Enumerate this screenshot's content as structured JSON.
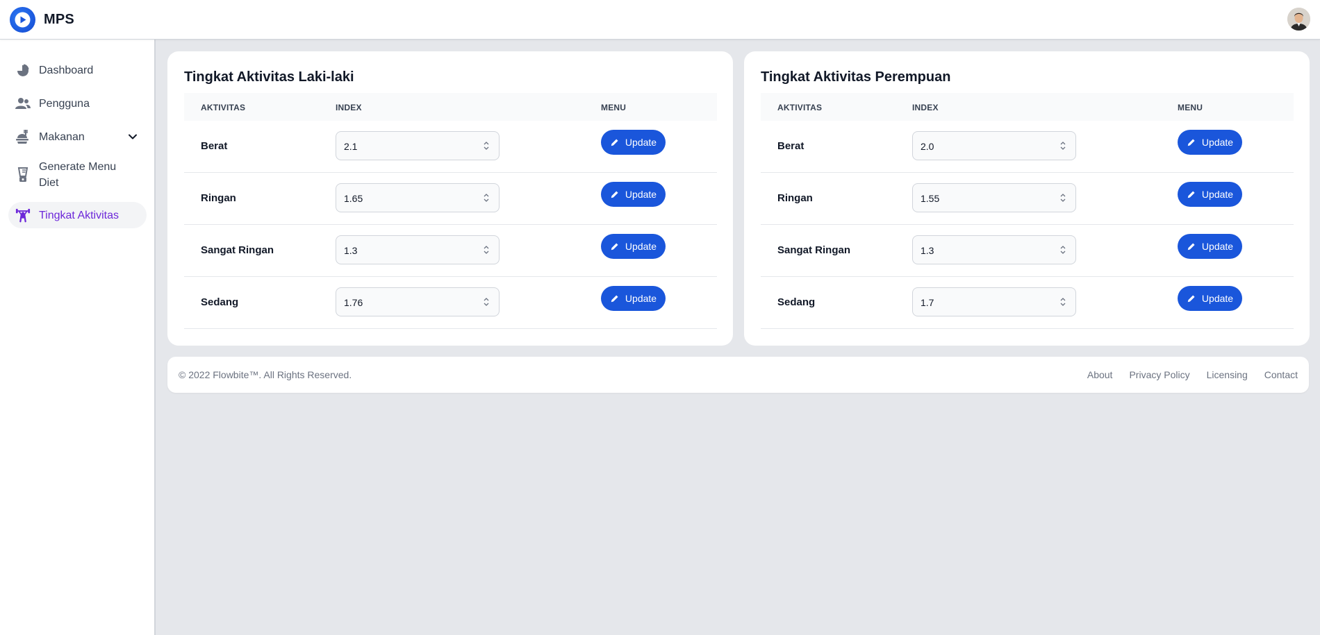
{
  "app": {
    "name": "MPS"
  },
  "sidebar": {
    "items": [
      {
        "label": "Dashboard",
        "icon": "chart-pie-icon"
      },
      {
        "label": "Pengguna",
        "icon": "users-icon"
      },
      {
        "label": "Makanan",
        "icon": "food-icon",
        "expandable": true
      },
      {
        "label": "Generate Menu Diet",
        "icon": "blender-icon"
      },
      {
        "label": "Tingkat Aktivitas",
        "icon": "weightlifter-icon",
        "active": true
      }
    ]
  },
  "tables": {
    "columns": [
      "AKTIVITAS",
      "INDEX",
      "MENU"
    ],
    "button_label": "Update",
    "male": {
      "title": "Tingkat Aktivitas Laki-laki",
      "rows": [
        {
          "name": "Berat",
          "index": "2.1"
        },
        {
          "name": "Ringan",
          "index": "1.65"
        },
        {
          "name": "Sangat Ringan",
          "index": "1.3"
        },
        {
          "name": "Sedang",
          "index": "1.76"
        }
      ]
    },
    "female": {
      "title": "Tingkat Aktivitas Perempuan",
      "rows": [
        {
          "name": "Berat",
          "index": "2.0"
        },
        {
          "name": "Ringan",
          "index": "1.55"
        },
        {
          "name": "Sangat Ringan",
          "index": "1.3"
        },
        {
          "name": "Sedang",
          "index": "1.7"
        }
      ]
    }
  },
  "footer": {
    "copyright": "© 2022 Flowbite™. All Rights Reserved.",
    "links": [
      "About",
      "Privacy Policy",
      "Licensing",
      "Contact"
    ]
  },
  "colors": {
    "primary": "#1a56db",
    "active_text": "#6d28d9",
    "background": "#e5e7eb"
  }
}
